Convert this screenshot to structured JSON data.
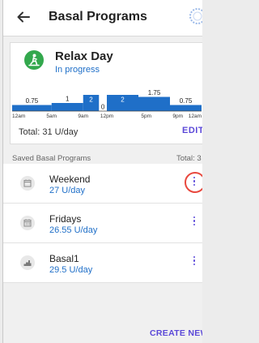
{
  "header": {
    "title": "Basal Programs"
  },
  "active_program": {
    "name": "Relax Day",
    "status": "In progress",
    "total": "Total: 31 U/day",
    "edit_label": "EDIT",
    "icon": "relax-person-icon",
    "chart_data": {
      "type": "bar",
      "segments": [
        {
          "start": "12am",
          "end": "5am",
          "rate": 0.75,
          "label": "0.75",
          "label_inside": false
        },
        {
          "start": "5am",
          "end": "9am",
          "rate": 1,
          "label": "1",
          "label_inside": false
        },
        {
          "start": "9am",
          "end": "11am",
          "rate": 2,
          "label": "2",
          "label_inside": true
        },
        {
          "start": "11am",
          "end": "12pm",
          "rate": 0,
          "label": "0",
          "label_inside": false
        },
        {
          "start": "12pm",
          "end": "4pm",
          "rate": 2,
          "label": "2",
          "label_inside": true
        },
        {
          "start": "4pm",
          "end": "8pm",
          "rate": 1.75,
          "label": "1.75",
          "label_inside": false
        },
        {
          "start": "8pm",
          "end": "12am",
          "rate": 0.75,
          "label": "0.75",
          "label_inside": false
        }
      ],
      "tick_labels": [
        "12am",
        "5am",
        "9am",
        "12pm",
        "5pm",
        "9pm",
        "12am"
      ],
      "colors": {
        "bar": "#1f6fc8",
        "inside_label": "#ffffff",
        "outside_label": "#222222"
      }
    }
  },
  "saved": {
    "label": "Saved Basal Programs",
    "total": "Total: 3",
    "items": [
      {
        "name": "Weekend",
        "rate": "27 U/day",
        "icon": "calendar-icon",
        "menu_icon": "kebab-menu-icon",
        "highlighted": true
      },
      {
        "name": "Fridays",
        "rate": "26.55 U/day",
        "icon": "calendar-grid-icon",
        "menu_icon": "kebab-menu-icon",
        "highlighted": false
      },
      {
        "name": "Basal1",
        "rate": "29.5 U/day",
        "icon": "basal-profile-icon",
        "menu_icon": "kebab-menu-icon",
        "highlighted": false
      }
    ]
  },
  "create_label": "CREATE NEW",
  "colors": {
    "accent": "#5b48d8",
    "link": "#1f6fc8",
    "active_icon": "#33a84d",
    "highlight_ring": "#e8483e"
  }
}
